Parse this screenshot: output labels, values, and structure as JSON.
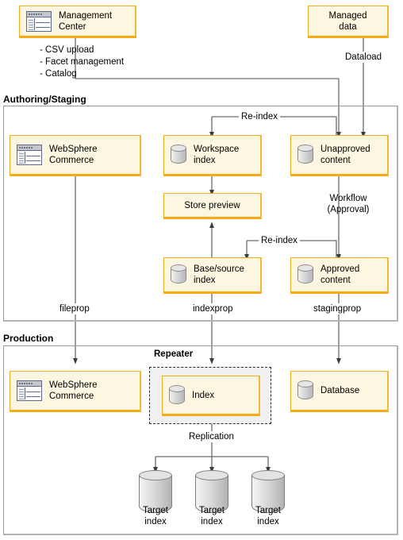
{
  "diagram": {
    "title": "WebSphere Commerce search index authoring staging and production topology",
    "colors": {
      "node_fill": "#fdf6e0",
      "node_border": "#f2ab1b",
      "node_border_bottom": "#fbaa16",
      "frame_border": "#9a9a9a",
      "repeater_fill": "#f0f0f0",
      "connector": "#4d4d4d",
      "cylinder": "#dcdcdc"
    }
  },
  "nodes": {
    "management_center": {
      "label": "Management\nCenter",
      "icon": "application-window-icon"
    },
    "managed_data": {
      "label": "Managed\ndata",
      "icon": "none"
    },
    "websphere_commerce_auth": {
      "label": "WebSphere\nCommerce",
      "icon": "application-window-icon"
    },
    "workspace_index": {
      "label": "Workspace\nindex",
      "icon": "database-cylinder-icon"
    },
    "unapproved_content": {
      "label": "Unapproved\ncontent",
      "icon": "database-cylinder-icon"
    },
    "store_preview": {
      "label": "Store preview",
      "icon": "none"
    },
    "base_source_index": {
      "label": "Base/source\nindex",
      "icon": "database-cylinder-icon"
    },
    "approved_content": {
      "label": "Approved\ncontent",
      "icon": "database-cylinder-icon"
    },
    "websphere_commerce_prod": {
      "label": "WebSphere\nCommerce",
      "icon": "application-window-icon"
    },
    "production_index": {
      "label": "Index",
      "icon": "database-cylinder-icon"
    },
    "database": {
      "label": "Database",
      "icon": "database-cylinder-icon"
    },
    "target_index_1": {
      "label": "Target\nindex",
      "icon": "database-cylinder-icon"
    },
    "target_index_2": {
      "label": "Target\nindex",
      "icon": "database-cylinder-icon"
    },
    "target_index_3": {
      "label": "Target\nindex",
      "icon": "database-cylinder-icon"
    }
  },
  "sections": {
    "authoring_staging": {
      "title": "Authoring/Staging"
    },
    "production": {
      "title": "Production"
    },
    "repeater": {
      "title": "Repeater"
    }
  },
  "labels": {
    "mc_operations": "- CSV upload\n- Facet management\n- Catalog",
    "dataload": "Dataload",
    "reindex_top": "Re-index",
    "reindex_bottom": "Re-index",
    "workflow_approval": "Workflow\n(Approval)",
    "fileprop": "fileprop",
    "indexprop": "indexprop",
    "stagingprop": "stagingprop",
    "replication": "Replication"
  }
}
